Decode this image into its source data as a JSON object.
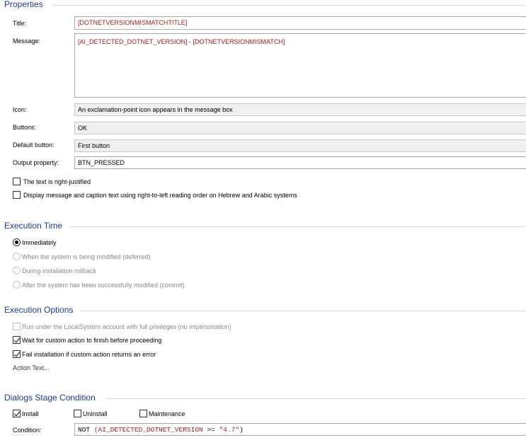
{
  "properties": {
    "section_title": "Properties",
    "title_label": "Title:",
    "title_value": "[DOTNETVERSIONMISMATCHTITLE]",
    "message_label": "Message:",
    "message_value": "[AI_DETECTED_DOTNET_VERSION] - [DOTNETVERSIONMISMATCH]",
    "icon_label": "Icon:",
    "icon_value": "An exclamation-point icon appears in the message box",
    "buttons_label": "Buttons:",
    "buttons_value": "OK",
    "default_button_label": "Default button:",
    "default_button_value": "First button",
    "output_property_label": "Output property:",
    "output_property_value": "BTN_PRESSED",
    "right_justified_label": "The text is right-justified",
    "right_justified_checked": false,
    "rtl_label": "Display message and caption text using right-to-left reading order on Hebrew and Arabic systems",
    "rtl_checked": false
  },
  "execution_time": {
    "section_title": "Execution Time",
    "options": [
      {
        "label": "Immediately",
        "selected": true,
        "enabled": true
      },
      {
        "label": "When the system is being modified (deferred)",
        "selected": false,
        "enabled": false
      },
      {
        "label": "During installation rollback",
        "selected": false,
        "enabled": false
      },
      {
        "label": "After the system has been successfully modified (commit)",
        "selected": false,
        "enabled": false
      }
    ]
  },
  "execution_options": {
    "section_title": "Execution Options",
    "localsystem_label": "Run under the LocalSystem account with full privileges (no impersonation)",
    "localsystem_checked": false,
    "wait_label": "Wait for custom action to finish before proceeding",
    "wait_checked": true,
    "fail_label": "Fail installation if custom action returns an error",
    "fail_checked": true,
    "action_text_label": "Action Text..."
  },
  "dialogs_stage": {
    "section_title": "Dialogs Stage Condition",
    "install_label": "Install",
    "install_checked": true,
    "uninstall_label": "Uninstall",
    "uninstall_checked": false,
    "maintenance_label": "Maintenance",
    "maintenance_checked": false,
    "condition_label": "Condition:",
    "condition_not": "NOT",
    "condition_open": "(",
    "condition_var": "AI_DETECTED_DOTNET_VERSION",
    "condition_op": ">=",
    "condition_str": "\"4.7\"",
    "condition_close": ")"
  }
}
